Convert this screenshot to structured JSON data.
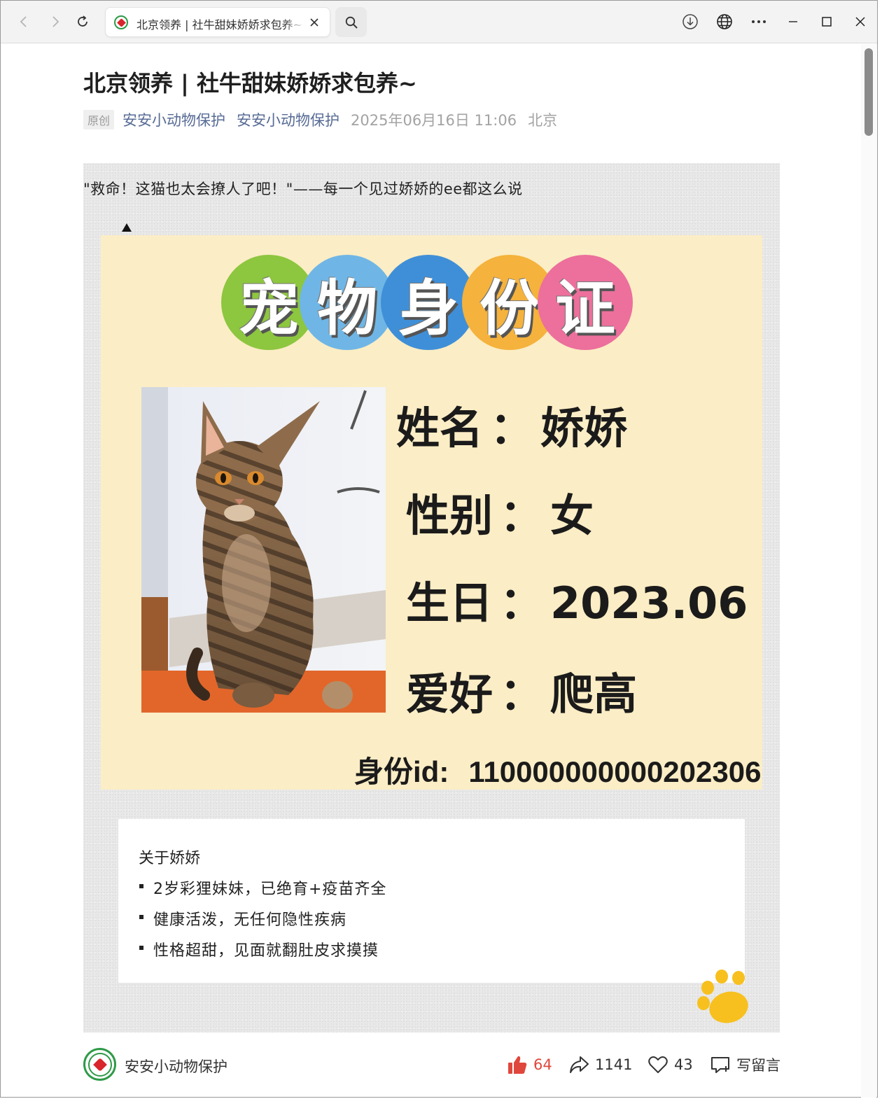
{
  "browser": {
    "tab_title": "北京领养 | 社牛甜妹娇娇求包养~",
    "icons": [
      "back-icon",
      "forward-icon",
      "refresh-icon",
      "close-icon",
      "search-icon",
      "download-icon",
      "globe-icon",
      "more-icon",
      "minimize-icon",
      "maximize-icon",
      "window-close-icon"
    ]
  },
  "article": {
    "title": "北京领养 | 社牛甜妹娇娇求包养~",
    "badge": "原创",
    "author_link_1": "安安小动物保护",
    "author_link_2": "安安小动物保护",
    "date": "2025年06月16日 11:06",
    "location": "北京",
    "lead": "\"救命！这猫也太会撩人了吧！\"——每一个见过娇娇的ee都这么说"
  },
  "id_card": {
    "header_chars": [
      "宠",
      "物",
      "身",
      "份",
      "证"
    ],
    "header_colors": [
      "#8dc63f",
      "#6fb6e6",
      "#3f8fd8",
      "#f5b23c",
      "#ec6f9c"
    ],
    "name_label": "姓名",
    "name_value": "娇娇",
    "gender_label": "性别",
    "gender_value": "女",
    "birthday_label": "生日",
    "birthday_value": "2023.06",
    "hobby_label": "爱好",
    "hobby_value": "爬高",
    "id_label": "身份id:",
    "id_value": "110000000000202306",
    "colon": "："
  },
  "about": {
    "heading": "关于娇娇",
    "items": [
      "2岁彩狸妹妹，已绝育+疫苗齐全",
      "健康活泼，无任何隐性疾病",
      "性格超甜，见面就翻肚皮求摸摸"
    ]
  },
  "footer": {
    "author": "安安小动物保护",
    "likes": "64",
    "shares": "1141",
    "favorites": "43",
    "comment_label": "写留言",
    "like_color": "#e0473c"
  }
}
